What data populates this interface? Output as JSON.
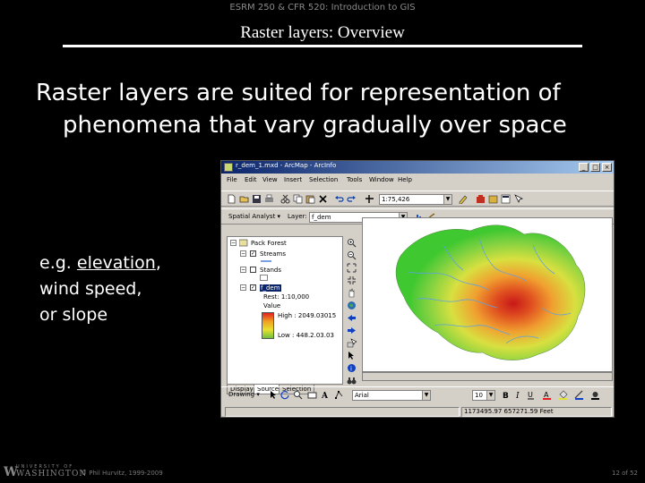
{
  "slide": {
    "course_header": "ESRM 250 & CFR 520: Introduction to GIS",
    "title": "Raster layers: Overview",
    "headline_line1": "Raster layers are suited for representation of",
    "headline_line2": "phenomena that vary gradually over space",
    "examples_prefix": "e.g. ",
    "example_1": "elevation",
    "example_1_sep": ",",
    "example_2": "wind speed,",
    "example_3": "or slope"
  },
  "footer": {
    "logo_top": "UNIVERSITY OF",
    "logo_bottom": "WASHINGTON",
    "copyright": "© Phil Hurvitz, 1999-2009",
    "page": "12 of 52"
  },
  "arcmap": {
    "window_title": "r_dem_1.mxd - ArcMap - ArcInfo",
    "menu": [
      "File",
      "Edit",
      "View",
      "Insert",
      "Selection",
      "Tools",
      "Window",
      "Help"
    ],
    "scale_value": "1:75,426",
    "spatial_analyst_label": "Spatial Analyst ▾",
    "layer_label": "Layer:",
    "layer_value": "f_dem",
    "toc": {
      "root": "Pack Forest",
      "layers": [
        "Streams",
        "Stands",
        "f_dem"
      ],
      "legend_lines": [
        "Rest: 1:10,000",
        "Value",
        "High : 2049.03015",
        "Low : 448.2.03.03"
      ]
    },
    "tabs": [
      "Display",
      "Source",
      "Selection"
    ],
    "drawing_label": "Drawing ▾",
    "font_value": "Arial",
    "font_size": "10",
    "status_coords": "1173495.97  657271.59 Feet",
    "accent_colors": {
      "titlebar": "#0a246a",
      "high": "#e02020",
      "low": "#70c040"
    }
  }
}
